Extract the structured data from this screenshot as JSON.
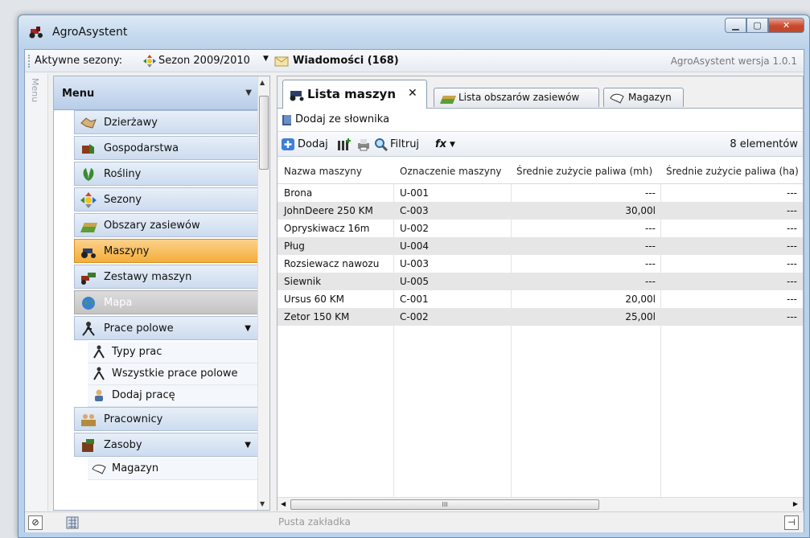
{
  "app": {
    "title": "AgroAsystent",
    "version": "AgroAsystent wersja 1.0.1"
  },
  "topbar": {
    "label": "Aktywne sezony:",
    "season": "Sezon 2009/2010",
    "messages": "Wiadomości (168)"
  },
  "sidebar_strip": {
    "label": "Menu"
  },
  "menu": {
    "title": "Menu",
    "items": [
      {
        "label": "Dzierżawy",
        "icon": "handshake-icon"
      },
      {
        "label": "Gospodarstwa",
        "icon": "farm-icon"
      },
      {
        "label": "Rośliny",
        "icon": "leaf-icon"
      },
      {
        "label": "Sezony",
        "icon": "season-icon"
      },
      {
        "label": "Obszary zasiewów",
        "icon": "field-icon"
      },
      {
        "label": "Maszyny",
        "icon": "tractor-icon"
      },
      {
        "label": "Zestawy maszyn",
        "icon": "machine-set-icon"
      },
      {
        "label": "Mapa",
        "icon": "globe-icon"
      },
      {
        "label": "Prace polowe",
        "icon": "field-work-icon"
      },
      {
        "label": "Typy prac",
        "icon": "work-type-icon"
      },
      {
        "label": "Wszystkie prace polowe",
        "icon": "all-work-icon"
      },
      {
        "label": "Dodaj pracę",
        "icon": "add-work-icon"
      },
      {
        "label": "Pracownicy",
        "icon": "workers-icon"
      },
      {
        "label": "Zasoby",
        "icon": "resources-icon"
      },
      {
        "label": "Magazyn",
        "icon": "warehouse-icon"
      }
    ]
  },
  "tabs": [
    {
      "label": "Lista maszyn",
      "close": "✕"
    },
    {
      "label": "Lista obszarów zasiewów"
    },
    {
      "label": "Magazyn"
    }
  ],
  "actions": {
    "add_from_dict": "Dodaj ze słownika",
    "add": "Dodaj",
    "filter": "Filtruj",
    "fx": "fx",
    "count": "8 elementów"
  },
  "grid": {
    "columns": [
      "Nazwa maszyny",
      "Oznaczenie maszyny",
      "Średnie zużycie paliwa (mh)",
      "Średnie zużycie paliwa (ha)"
    ],
    "rows": [
      [
        "Brona",
        "U-001",
        "---",
        "---"
      ],
      [
        "JohnDeere 250 KM",
        "C-003",
        "30,00l",
        "---"
      ],
      [
        "Opryskiwacz 16m",
        "U-002",
        "---",
        "---"
      ],
      [
        "Pług",
        "U-004",
        "---",
        "---"
      ],
      [
        "Rozsiewacz nawozu",
        "U-003",
        "---",
        "---"
      ],
      [
        "Siewnik",
        "U-005",
        "---",
        "---"
      ],
      [
        "Ursus 60 KM",
        "C-001",
        "20,00l",
        "---"
      ],
      [
        "Zetor 150 KM",
        "C-002",
        "25,00l",
        "---"
      ]
    ]
  },
  "statusbar": {
    "empty_tab": "Pusta zakładka"
  }
}
